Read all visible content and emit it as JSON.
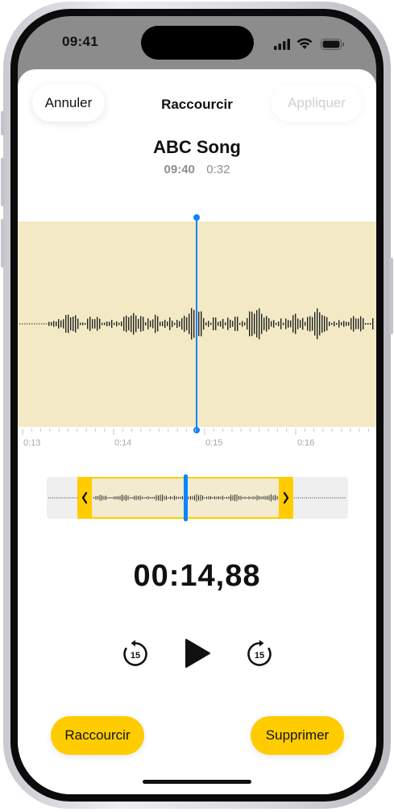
{
  "status_bar": {
    "time": "09:41"
  },
  "nav": {
    "cancel_label": "Annuler",
    "title": "Raccourcir",
    "apply_label": "Appliquer"
  },
  "recording": {
    "title": "ABC Song",
    "date_time": "09:40",
    "duration": "0:32"
  },
  "timeline": {
    "tick_labels": [
      "0:13",
      "0:14",
      "0:15",
      "0:16"
    ]
  },
  "playback": {
    "current_time": "00:14,88",
    "skip_back_label": "15",
    "skip_forward_label": "15"
  },
  "actions": {
    "trim_label": "Raccourcir",
    "delete_label": "Supprimer"
  },
  "colors": {
    "accent_yellow": "#ffcc00",
    "playhead_blue": "#0a84ff",
    "selection_fill": "#f3e9c4"
  },
  "icons": {
    "play": "play-icon",
    "skip_back": "skip-back-15-icon",
    "skip_forward": "skip-forward-15-icon",
    "signal": "cellular-signal-icon",
    "wifi": "wifi-icon",
    "battery": "battery-icon"
  }
}
